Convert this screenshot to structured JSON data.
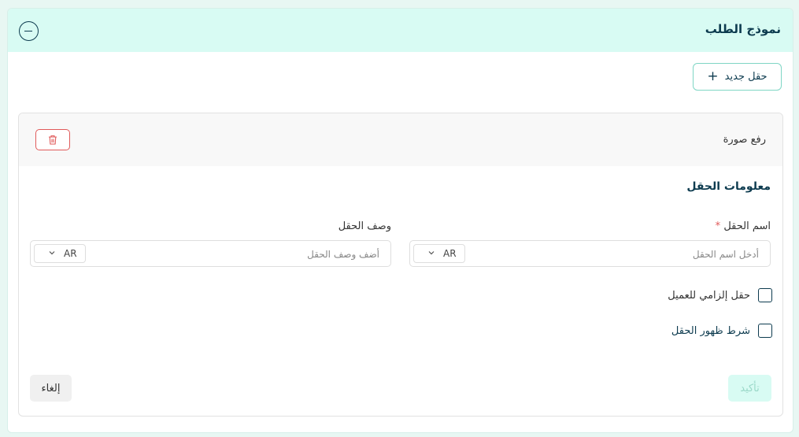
{
  "header": {
    "title": "نموذج الطلب",
    "collapse_icon": "minus-circle-icon"
  },
  "toolbar": {
    "new_field_label": "حقل جديد",
    "new_field_icon": "plus-icon"
  },
  "field_panel": {
    "title": "رفع صورة",
    "delete_icon": "trash-icon",
    "section_title": "معلومات الحقل",
    "name": {
      "label": "اسم الحقل",
      "required_mark": "*",
      "placeholder": "أدخل اسم الحقل",
      "lang": "AR"
    },
    "description": {
      "label": "وصف الحقل",
      "placeholder": "أضف وصف الحقل",
      "lang": "AR"
    },
    "required_checkbox_label": "حقل إلزامي للعميل",
    "visibility_checkbox_label": "شرط ظهور الحقل",
    "confirm_label": "تأكيد",
    "cancel_label": "إلغاء"
  },
  "colors": {
    "accent": "#d8fbf3",
    "primary_text": "#0d3b4f",
    "danger": "#e05a5a"
  }
}
